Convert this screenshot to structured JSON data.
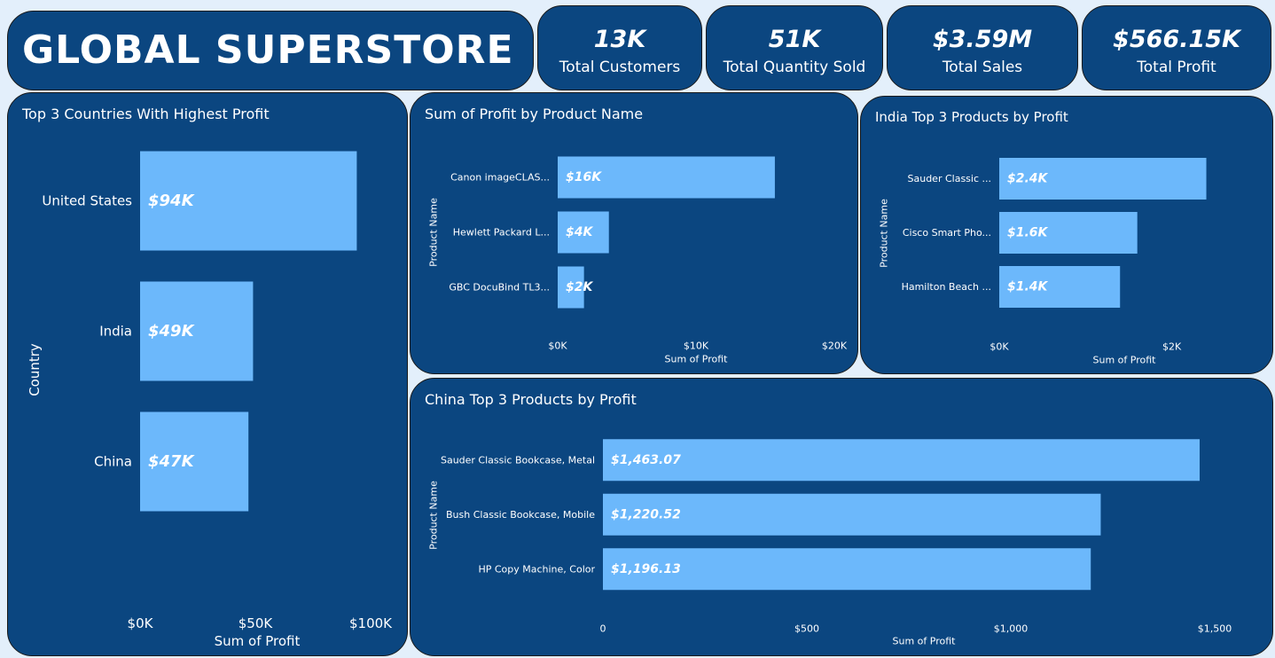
{
  "header": {
    "title": "GLOBAL SUPERSTORE"
  },
  "kpis": [
    {
      "value": "13K",
      "label": "Total Customers"
    },
    {
      "value": "51K",
      "label": "Total Quantity Sold"
    },
    {
      "value": "$3.59M",
      "label": "Total Sales"
    },
    {
      "value": "$566.15K",
      "label": "Total Profit"
    }
  ],
  "colors": {
    "background": "#e3effb",
    "card": "#0b4680",
    "bar": "#6cb8fb",
    "text": "#ffffff"
  },
  "chart_data": [
    {
      "id": "countries",
      "type": "bar",
      "orientation": "horizontal",
      "title": "Top 3 Countries With Highest Profit",
      "xlabel": "Sum of Profit",
      "ylabel": "Country",
      "categories": [
        "United States",
        "India",
        "China"
      ],
      "values": [
        94000,
        49000,
        47000
      ],
      "data_labels": [
        "$94K",
        "$49K",
        "$47K"
      ],
      "xlim": [
        0,
        100000
      ],
      "xticks": [
        0,
        50000,
        100000
      ],
      "xtick_labels": [
        "$0K",
        "$50K",
        "$100K"
      ],
      "grid": false,
      "legend": "none"
    },
    {
      "id": "products",
      "type": "bar",
      "orientation": "horizontal",
      "title": "Sum of Profit by Product Name",
      "xlabel": "Sum of Profit",
      "ylabel": "Product Name",
      "categories": [
        "Canon imageCLAS...",
        "Hewlett Packard L...",
        "GBC DocuBind TL3..."
      ],
      "values": [
        15700,
        3700,
        1900
      ],
      "data_labels": [
        "$16K",
        "$4K",
        "$2K"
      ],
      "xlim": [
        0,
        20000
      ],
      "xticks": [
        0,
        10000,
        20000
      ],
      "xtick_labels": [
        "$0K",
        "$10K",
        "$20K"
      ],
      "grid": false,
      "legend": "none"
    },
    {
      "id": "india",
      "type": "bar",
      "orientation": "horizontal",
      "title": "India Top 3 Products by Profit",
      "xlabel": "Sum of Profit",
      "ylabel": "Product Name",
      "categories": [
        "Sauder Classic ...",
        "Cisco Smart Pho...",
        "Hamilton Beach ..."
      ],
      "values": [
        2400,
        1600,
        1400
      ],
      "data_labels": [
        "$2.4K",
        "$1.6K",
        "$1.4K"
      ],
      "xlim": [
        0,
        2600
      ],
      "xticks": [
        0,
        2000
      ],
      "xtick_labels": [
        "$0K",
        "$2K"
      ],
      "grid": false,
      "legend": "none"
    },
    {
      "id": "china",
      "type": "bar",
      "orientation": "horizontal",
      "title": "China Top 3 Products by Profit",
      "xlabel": "Sum of Profit",
      "ylabel": "Product Name",
      "categories": [
        "Sauder Classic Bookcase, Metal",
        "Bush Classic Bookcase, Mobile",
        "HP Copy Machine, Color"
      ],
      "values": [
        1463.07,
        1220.52,
        1196.13
      ],
      "data_labels": [
        "$1,463.07",
        "$1,220.52",
        "$1,196.13"
      ],
      "xlim": [
        0,
        1500
      ],
      "xticks": [
        0,
        500,
        1000,
        1500
      ],
      "xtick_labels": [
        "0",
        "$500",
        "$1,000",
        "$1,500"
      ],
      "grid": false,
      "legend": "none"
    }
  ]
}
